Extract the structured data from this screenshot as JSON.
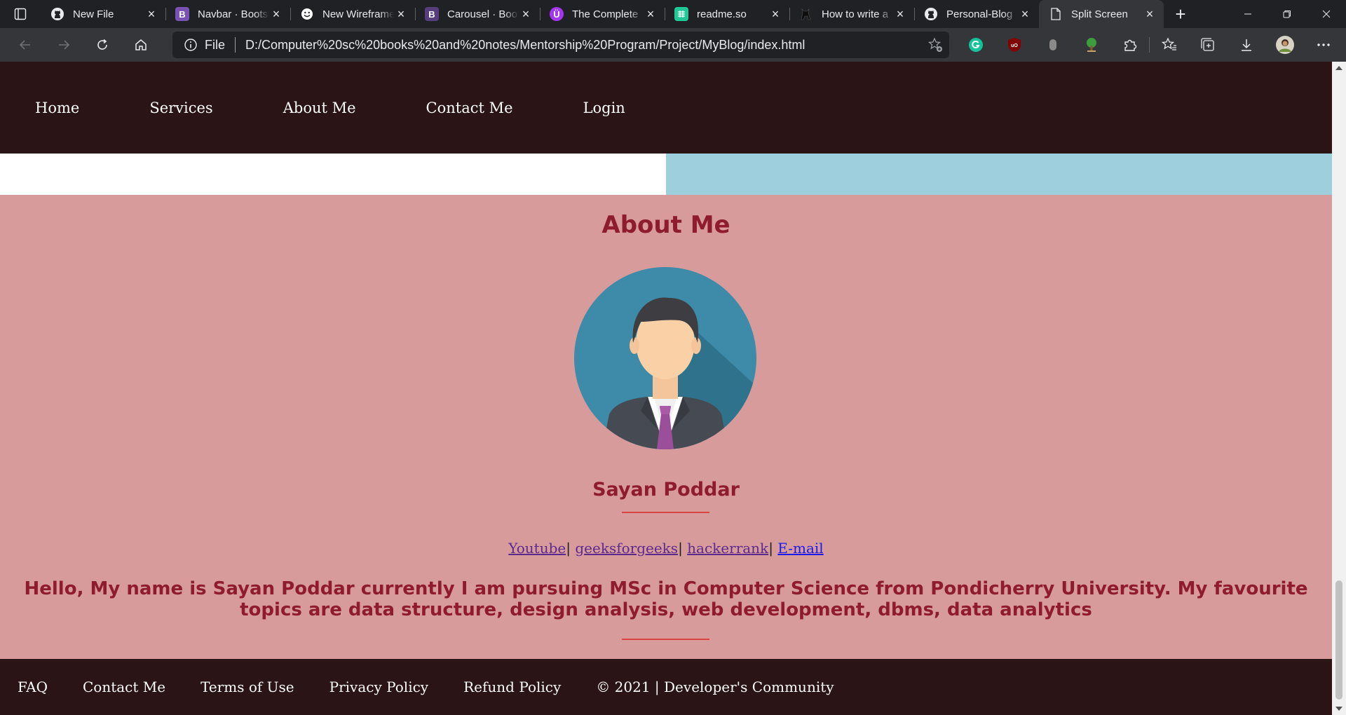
{
  "browser": {
    "tabs": [
      {
        "title": "New File",
        "icon": "github-icon"
      },
      {
        "title": "Navbar · Bootstrap",
        "icon": "bootstrap-icon"
      },
      {
        "title": "New Wireframe",
        "icon": "smiley-icon"
      },
      {
        "title": "Carousel · Bootstrap",
        "icon": "bootstrap-icon"
      },
      {
        "title": "The Complete",
        "icon": "u-icon"
      },
      {
        "title": "readme.so",
        "icon": "readme-icon"
      },
      {
        "title": "How to write a",
        "icon": "cat-icon"
      },
      {
        "title": "Personal-Blog",
        "icon": "github-icon"
      },
      {
        "title": "Split Screen",
        "icon": "page-icon"
      }
    ],
    "address": {
      "scheme": "File",
      "url": "D:/Computer%20sc%20books%20and%20notes/Mentorship%20Program/Project/MyBlog/index.html"
    },
    "colors": {
      "frame": "#202124",
      "toolbar": "#35363a",
      "active_tab": "#35363a"
    }
  },
  "page": {
    "nav": [
      "Home",
      "Services",
      "About Me",
      "Contact Me",
      "Login"
    ],
    "about": {
      "heading": "About Me",
      "name": "Sayan Poddar",
      "links": [
        {
          "label": "Youtube",
          "sep": "|"
        },
        {
          "label": "geeksforgeeks",
          "sep": "|"
        },
        {
          "label": "hackerrank",
          "sep": "|"
        },
        {
          "label": "E-mail",
          "sep": ""
        }
      ],
      "bio": "Hello, My name is Sayan Poddar currently I am pursuing MSc in Computer Science from Pondicherry University. My favourite topics are data structure, design analysis, web development, dbms, data analytics"
    },
    "footer": [
      "FAQ",
      "Contact Me",
      "Terms of Use",
      "Privacy Policy",
      "Refund Policy",
      "© 2021 | Developer's Community"
    ],
    "colors": {
      "nav_bg": "#2a1416",
      "about_bg": "#d89b9b",
      "accent_text": "#8f1b2e",
      "divider": "#d94444",
      "strip_right": "#9ecfdc"
    }
  }
}
